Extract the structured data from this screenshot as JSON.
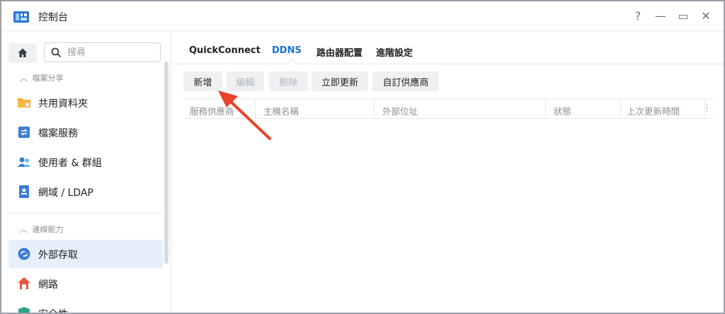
{
  "window": {
    "title": "控制台",
    "controls": {
      "help": "?",
      "minimize": "—",
      "maximize": "▭",
      "close": "✕"
    }
  },
  "sidebar": {
    "search_placeholder": "搜尋",
    "sections": [
      {
        "label": "檔案分享",
        "items": [
          {
            "label": "共用資料夾",
            "icon": "folder-icon"
          },
          {
            "label": "檔案服務",
            "icon": "file-services-icon"
          },
          {
            "label": "使用者 & 群組",
            "icon": "users-icon"
          },
          {
            "label": "網域 / LDAP",
            "icon": "directory-icon"
          }
        ]
      },
      {
        "label": "連線能力",
        "items": [
          {
            "label": "外部存取",
            "icon": "external-access-icon",
            "active": true
          },
          {
            "label": "網路",
            "icon": "network-icon"
          },
          {
            "label": "安全性",
            "icon": "shield-icon"
          }
        ]
      }
    ]
  },
  "tabs": [
    {
      "label": "QuickConnect",
      "active": false
    },
    {
      "label": "DDNS",
      "active": true
    },
    {
      "label": "路由器配置",
      "active": false
    },
    {
      "label": "進階設定",
      "active": false
    }
  ],
  "toolbar": {
    "add": "新增",
    "edit": "編輯",
    "delete": "刪除",
    "update_now": "立即更新",
    "custom_provider": "自訂供應商"
  },
  "table": {
    "columns": [
      "服務供應商",
      "主機名稱",
      "外部位址",
      "狀態",
      "上次更新時間"
    ],
    "menu_glyph": "⋮",
    "rows": []
  },
  "colors": {
    "accent": "#1a73d0",
    "annotation_arrow": "#e8412c",
    "active_nav_bg": "#e6f0fa"
  }
}
